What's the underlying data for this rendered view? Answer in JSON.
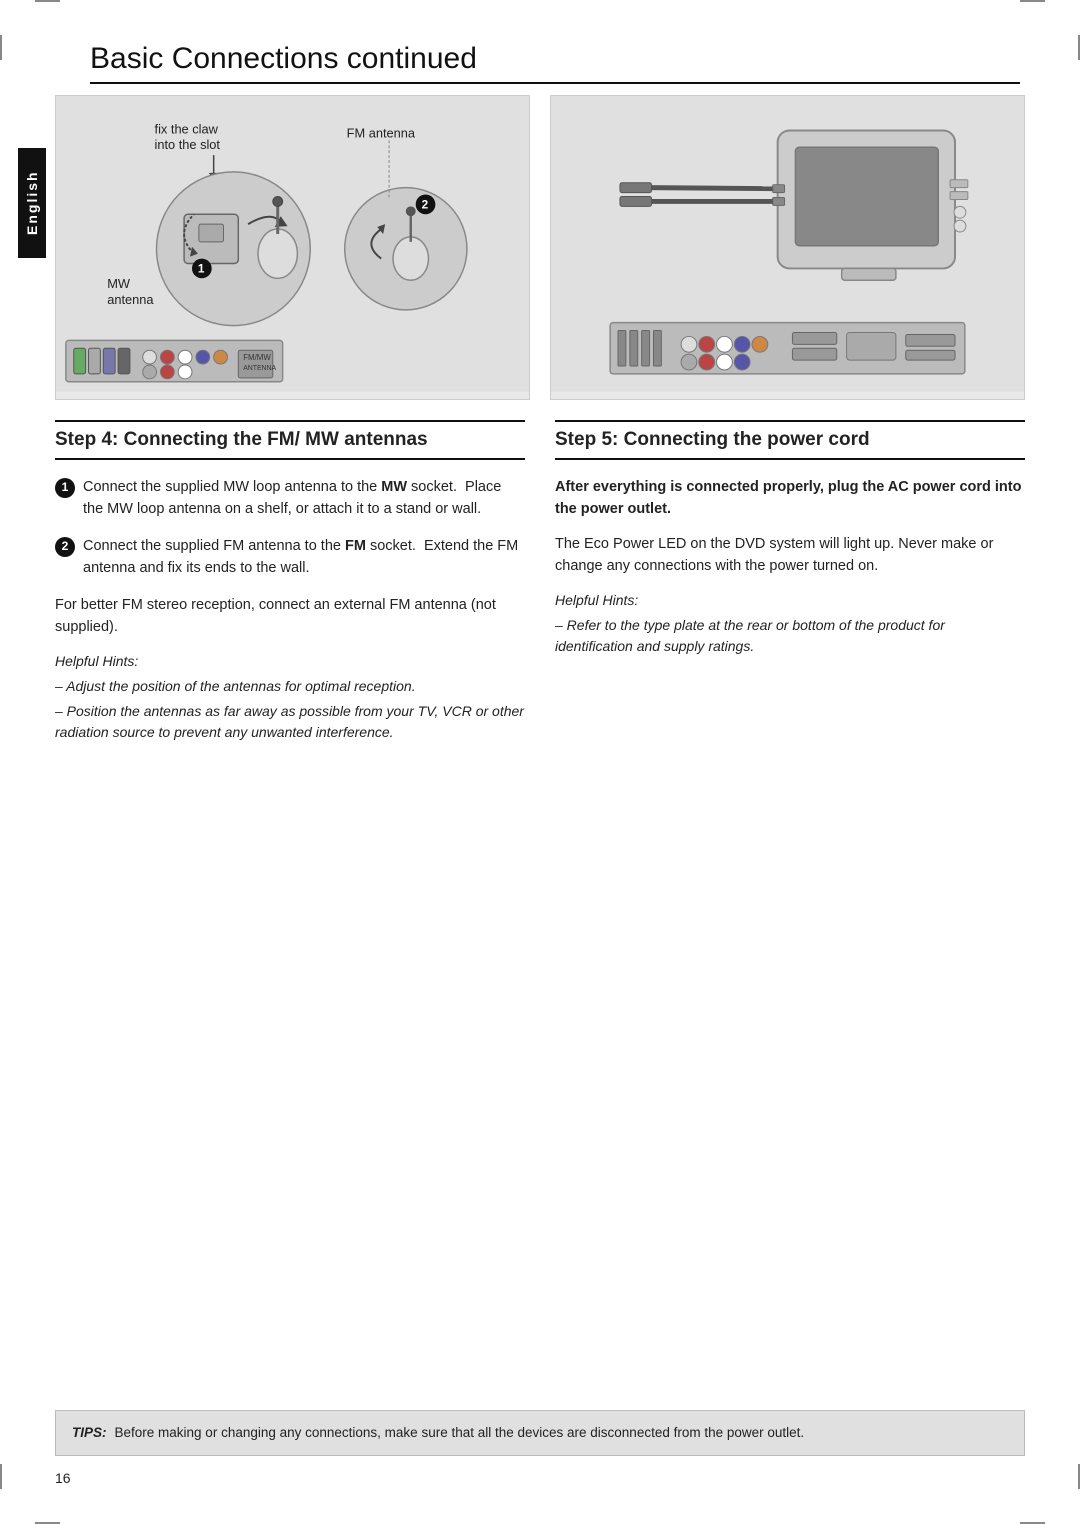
{
  "page": {
    "title": "Basic Connections",
    "title_suffix": " continued",
    "page_number": "16",
    "language_tab": "English"
  },
  "tips_bar": {
    "label": "TIPS:",
    "text": "Before making or changing any connections, make sure that all the devices are disconnected from the power outlet."
  },
  "left_diagram": {
    "label1": "fix the claw",
    "label2": "into the slot",
    "label3": "FM antenna",
    "label4": "MW",
    "label5": "antenna",
    "num1": "1",
    "num2": "2"
  },
  "step4": {
    "heading": "Step 4:  Connecting the FM/ MW antennas",
    "item1": "Connect the supplied MW loop antenna to the MW socket.  Place the MW loop antenna on a shelf, or attach it to a stand or wall.",
    "item1_bold": "MW",
    "item2": "Connect the supplied FM antenna to the FM socket.  Extend the FM antenna and fix its ends to the wall.",
    "item2_bold1": "FM",
    "item2_bold2": "FM",
    "para": "For better FM stereo reception, connect an external FM antenna (not supplied).",
    "helpful_hints": "Helpful Hints:",
    "hint1": "– Adjust the position of the antennas for optimal reception.",
    "hint2": "– Position the antennas as far away as possible from your TV, VCR or other radiation source to prevent any unwanted interference."
  },
  "step5": {
    "heading": "Step 5:  Connecting the power cord",
    "bold_text": "After everything is connected properly, plug the AC power cord into the power outlet.",
    "para": "The Eco Power LED on the DVD system will light up. Never make or change any connections with the power turned on.",
    "helpful_hints": "Helpful Hints:",
    "hint1": "– Refer to the type plate at the rear or bottom of the product for identification and supply ratings."
  }
}
